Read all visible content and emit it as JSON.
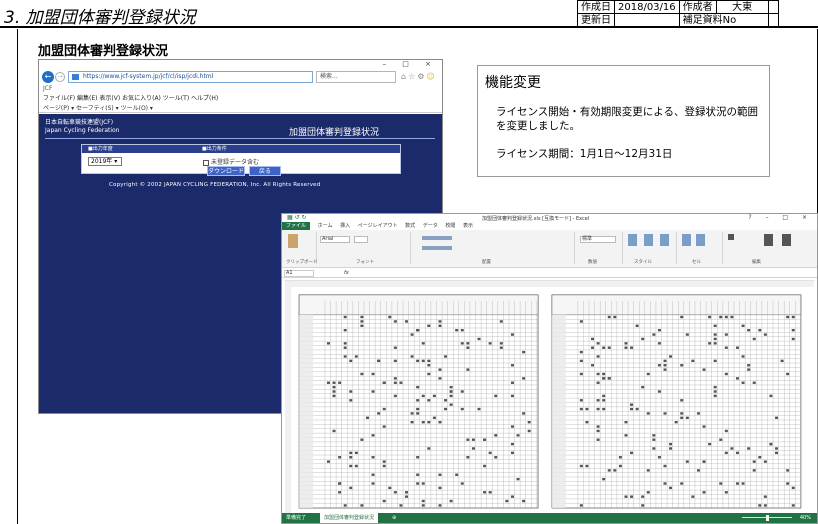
{
  "doc": {
    "title": "3. 加盟団体審判登録状況",
    "created_label": "作成日",
    "created_date": "2018/03/16",
    "author_label": "作成者",
    "author_name": "大東",
    "updated_label": "更新日",
    "updated_value": "",
    "supplement_label": "補足資料No",
    "supplement_value": ""
  },
  "section_title": "加盟団体審判登録状況",
  "browser": {
    "window_controls": "– □ ×",
    "address": "https://www.jcf-system.jp/jcf/cl/isp/jcdi.html",
    "search_placeholder": "検索...",
    "tab_label": "JCF",
    "menu": "ファイル(F)  編集(E)  表示(V)  お気に入り(A)  ツール(T)  ヘルプ(H)",
    "command_bar": "ページ(P) ▾  セーフティ(S) ▾  ツール(O) ▾",
    "page": {
      "org_name_ja": "日本自転車競技連盟(JCF)",
      "org_name_en": "Japan Cycling Federation",
      "page_title": "加盟団体審判登録状況",
      "col_year_label": "■出力年度",
      "col_option_label": "■出力条件",
      "year_value": "2019年",
      "checkbox_label": "未登録データ含む",
      "download_button": "ダウンロード",
      "back_button": "戻る",
      "copyright": "Copyright © 2002 JAPAN CYCLING FEDERATION, Inc. All Rights Reserved"
    }
  },
  "callout": {
    "title": "機能変更",
    "body": "ライセンス開始・有効期限変更による、登録状況の範囲を変更しました。",
    "period": "ライセンス期間：1月1日～12月31日"
  },
  "excel": {
    "title": "加盟団体審判登録状況.xls [互換モード] - Excel",
    "tabs": [
      "ファイル",
      "ホーム",
      "挿入",
      "ページレイアウト",
      "数式",
      "データ",
      "校閲",
      "表示"
    ],
    "font_name": "Arial",
    "number_format": "標準",
    "ribbon_groups": [
      "クリップボード",
      "フォント",
      "配置",
      "数値",
      "スタイル",
      "セル",
      "編集"
    ],
    "name_box": "A1",
    "fx": "fx",
    "status_ready": "準備完了",
    "sheet_tab": "加盟団体審判登録状況",
    "zoom": "40%"
  }
}
